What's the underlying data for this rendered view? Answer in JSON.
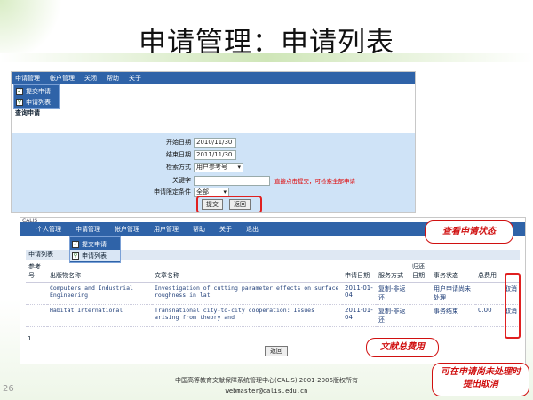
{
  "slide": {
    "title": "申请管理：申请列表",
    "footer_org": "中国高等教育文献保障系统管理中心(CALIS) 2001-2006版权所有",
    "footer_email": "webmaster@calis.edu.cn",
    "page_number": "26"
  },
  "shot1": {
    "menu": [
      "申请管理",
      "帐户管理",
      "关闭",
      "帮助",
      "关于"
    ],
    "dropdown": [
      "提交申请",
      "申请列表"
    ],
    "section_title": "查询申请",
    "form": {
      "start_date_label": "开始日期",
      "start_date_value": "2010/11/30",
      "end_date_label": "结束日期",
      "end_date_value": "2011/11/30",
      "search_mode_label": "检索方式",
      "search_mode_value": "用户参考号",
      "keyword_label": "关键字",
      "keyword_value": "",
      "hint": "直接点击提交，可检索全部申请",
      "condition_label": "申请限定条件",
      "condition_value": "全部"
    },
    "submit_label": "提交",
    "back_label": "返回"
  },
  "shot2": {
    "logo": "CALIS",
    "menu": [
      "个人管理",
      "申请管理",
      "帐户管理",
      "用户管理",
      "帮助",
      "关于",
      "退出"
    ],
    "dropdown": [
      "提交申请",
      "申请列表"
    ],
    "tab_header": "申请列表",
    "columns": [
      "参考号",
      "出版物名称",
      "文章名称",
      "申请日期",
      "服务方式",
      "归还日期",
      "事务状态",
      "总费用",
      ""
    ],
    "rows": [
      {
        "ref": "",
        "pub": "Computers and Industrial Engineering",
        "article": "Investigation of cutting parameter effects on surface roughness in lat",
        "date": "2011-01-04",
        "service": "复制-非返还",
        "return": "",
        "status": "用户申请尚未处理",
        "fee": "",
        "action": "取消"
      },
      {
        "ref": "",
        "pub": "Habitat International",
        "article": "Transnational city-to-city cooperation: Issues arising from theory and",
        "date": "2011-01-04",
        "service": "复制-非返还",
        "return": "",
        "status": "事务结束",
        "fee": "0.00",
        "action": "取消"
      }
    ],
    "pager": "1",
    "back_label": "返回"
  },
  "callouts": {
    "status": "查看申请状态",
    "fee": "文献总费用",
    "cancel": "可在申请尚未处理时提出取消"
  }
}
